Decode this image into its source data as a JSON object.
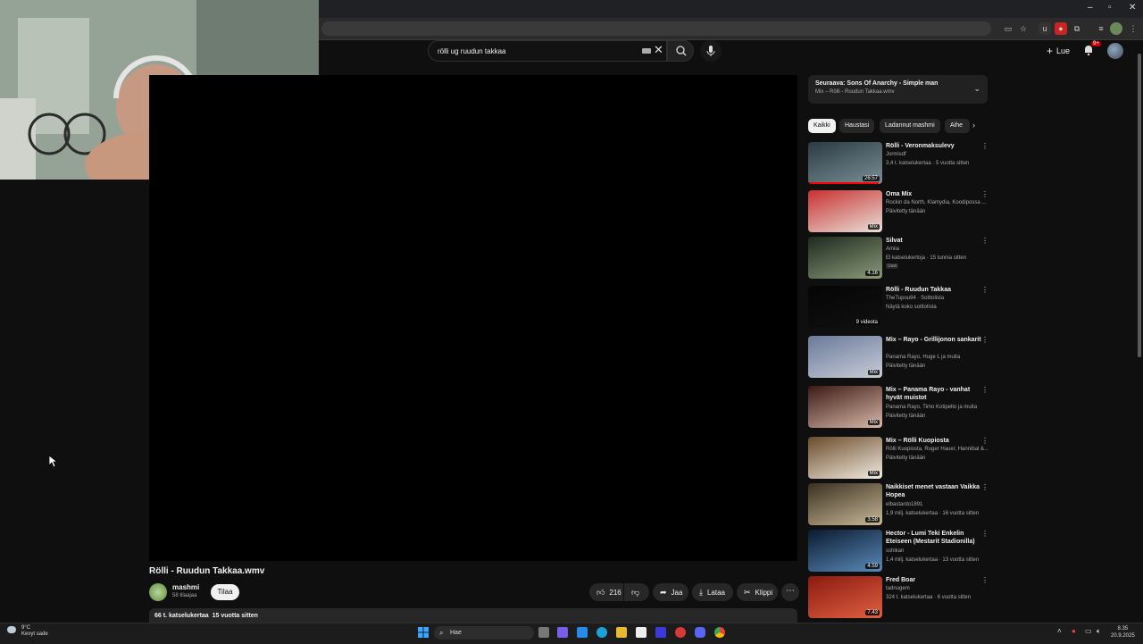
{
  "search": {
    "query": "rölli ug ruudun takkaa"
  },
  "header": {
    "signin_label": "Lue",
    "notification_count": "9+"
  },
  "video": {
    "title": "Rölli - Ruudun Takkaa.wmv",
    "channel": "mashmi",
    "subscribers": "58 tilaajaa",
    "subscribe_label": "Tilaa",
    "likes": "216",
    "share_label": "Jaa",
    "download_label": "Lataa",
    "clip_label": "Klippi",
    "description_stats": "66 t. katselukertaa  15 vuotta sitten"
  },
  "up_next": {
    "title": "Seuraava: Sons Of Anarchy - Simple man",
    "subtitle": "Mix – Rölli - Ruudun Takkaa.wmv"
  },
  "chips": [
    {
      "label": "Kaikki"
    },
    {
      "label": "Haustasi"
    },
    {
      "label": "Ladannut mashmi"
    },
    {
      "label": "Aihe"
    }
  ],
  "recommendations": [
    {
      "title": "Rölli - Veronmaksulevy",
      "channel": "Jormisdf",
      "stats": "3,4 t. katselukertaa · 5 vuotta sitten",
      "duration": "26:57",
      "thumb": [
        "#2b3a44",
        "#7a8f95"
      ],
      "progress": 0.95
    },
    {
      "title": "Oma Mix",
      "channel": "Rockin da North, Klamydia, Koodipossa ...",
      "stats": "Päivitetty tänään",
      "duration": "Mix",
      "thumb": [
        "#c93030",
        "#e8e0d8"
      ]
    },
    {
      "title": "Silvat",
      "channel": "Amiia",
      "stats": "El katselukertoja · 15 tunnia sitten",
      "badge": "Uusi",
      "duration": "4.16",
      "thumb": [
        "#1e2a1e",
        "#8a9a7a"
      ]
    },
    {
      "title": "Rölli - Ruudun Takkaa",
      "channel": "TheTupou94 · Soittolista",
      "stats": "Näytä koko soittolista",
      "duration": "9 videota",
      "thumb": [
        "#050505",
        "#101010"
      ]
    },
    {
      "title": "Mix – Rayo - Grillijonon sankarit",
      "channel": "Panama Rayo, Huge L ja muita",
      "stats": "Päivitetty tänään",
      "duration": "Mix",
      "thumb": [
        "#6a7a9a",
        "#c8ccd8"
      ]
    },
    {
      "title": "Mix – Panama Rayo - vanhat hyvät muistot",
      "channel": "Panama Rayo, Timo Kotipelto ja muita",
      "stats": "Päivitetty tänään",
      "duration": "Mix",
      "thumb": [
        "#3a1a14",
        "#d8b8a8"
      ]
    },
    {
      "title": "Mix – Rölli Kuopiosta",
      "channel": "Rölli Kuopiosta, Ruger Hauer, Hannibal &...",
      "stats": "Päivitetty tänään",
      "duration": "Mix",
      "thumb": [
        "#6a4a2a",
        "#f2ece0"
      ]
    },
    {
      "title": "Naikkiset menet vastaan Vaikka Hopea",
      "channel": "elbastardo1891",
      "stats": "1,9 milj. katselukertaa · 16 vuotta sitten",
      "duration": "3.58",
      "thumb": [
        "#3a3020",
        "#c8b898"
      ]
    },
    {
      "title": "Hector - Lumi Teki Enkelin Eteiseen (Mestarit Stadionilla)",
      "channel": "sshikan",
      "stats": "1,4 milj. katselukertaa · 13 vuotta sitten",
      "duration": "4.59",
      "thumb": [
        "#0a1a30",
        "#5a8ab8"
      ]
    },
    {
      "title": "Fred Boar",
      "channel": "tadnugem",
      "stats": "324 t. katselukertaa · 6 vuotta sitten",
      "duration": "7.43",
      "thumb": [
        "#8a1a10",
        "#e06040"
      ]
    }
  ],
  "taskbar": {
    "weather_temp": "9°C",
    "weather_text": "Kevyt sade",
    "search_label": "Hae",
    "time": "8.35",
    "date": "20.9.2025"
  },
  "colors": {
    "background": "#0f0f0f",
    "accent": "#ff0000",
    "chip_active": "#f1f1f1"
  }
}
